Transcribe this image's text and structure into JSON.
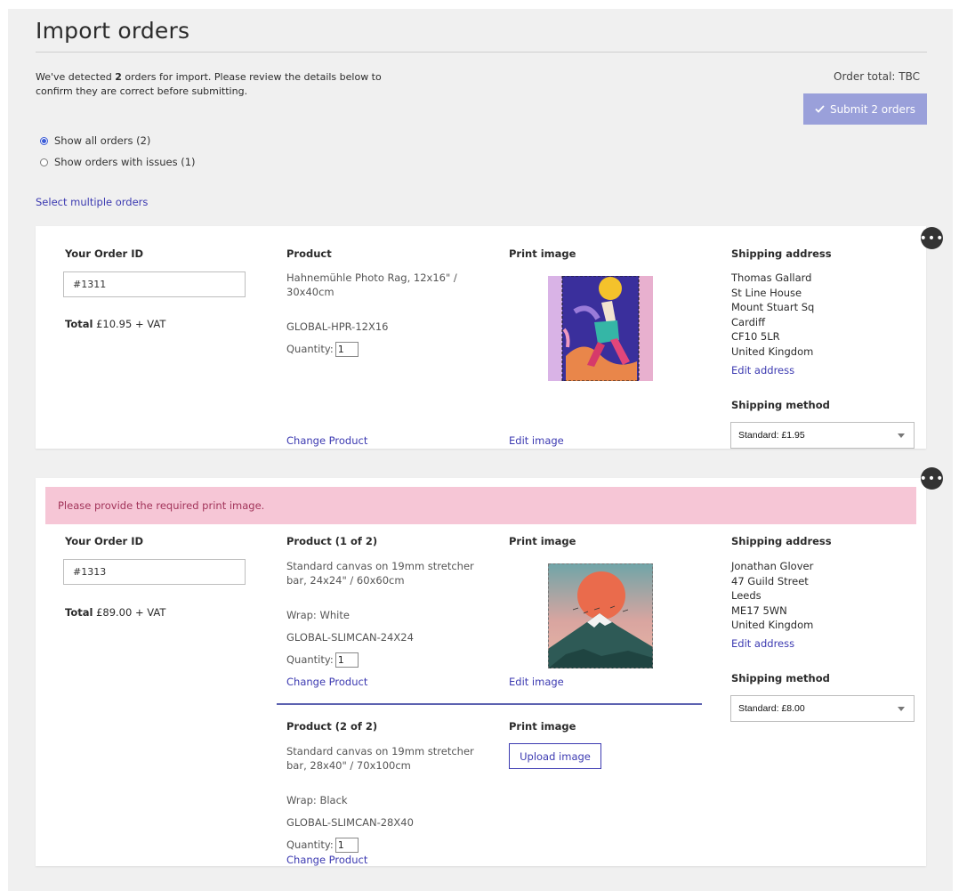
{
  "page": {
    "title": "Import orders",
    "intro_prefix": "We've detected ",
    "intro_count": "2",
    "intro_suffix": " orders for import. Please review the details below to confirm they are correct before submitting.",
    "order_total": "Order total: TBC",
    "submit_label": "Submit 2 orders",
    "filters": [
      {
        "label": "Show all orders (2)",
        "selected": true
      },
      {
        "label": "Show orders with issues (1)",
        "selected": false
      }
    ],
    "select_multiple": "Select multiple orders"
  },
  "labels": {
    "order_id": "Your Order ID",
    "print_image": "Print image",
    "shipping_address": "Shipping address",
    "shipping_method": "Shipping method",
    "total": "Total",
    "quantity": "Quantity:",
    "change_product": "Change Product",
    "edit_image": "Edit image",
    "edit_address": "Edit address",
    "upload_image": "Upload image"
  },
  "orders": [
    {
      "order_id": "#1311",
      "total_value": " £10.95 + VAT",
      "product_heading": "Product",
      "product_name_line1": "Hahnemühle Photo Rag, 12x16\" /",
      "product_name_line2": "30x40cm",
      "sku": "GLOBAL-HPR-12X16",
      "quantity": "1",
      "address": [
        "Thomas Gallard",
        "St Line House",
        "Mount Stuart Sq",
        "Cardiff",
        "CF10 5LR",
        "United Kingdom"
      ],
      "shipping_method": "Standard: £1.95"
    },
    {
      "alert": "Please provide the required print image.",
      "order_id": "#1313",
      "total_value": " £89.00 + VAT",
      "address": [
        "Jonathan Glover",
        "47 Guild Street",
        "Leeds",
        "ME17 5WN",
        "United Kingdom"
      ],
      "shipping_method": "Standard: £8.00",
      "products": [
        {
          "heading": "Product (1 of 2)",
          "name_line1": "Standard canvas on 19mm stretcher",
          "name_line2": "bar, 24x24\" / 60x60cm",
          "wrap": "Wrap: White",
          "sku": "GLOBAL-SLIMCAN-24X24",
          "quantity": "1"
        },
        {
          "heading": "Product (2 of 2)",
          "name_line1": "Standard canvas on 19mm stretcher",
          "name_line2": "bar, 28x40\" / 70x100cm",
          "wrap": "Wrap: Black",
          "sku": "GLOBAL-SLIMCAN-28X40",
          "quantity": "1"
        }
      ]
    }
  ],
  "colors": {
    "accent": "#3c3ab1",
    "submit_bg": "#9aa0da",
    "alert_bg": "#f6c6d6",
    "alert_text": "#a2345a"
  },
  "icons": {
    "submit": "check-icon",
    "more": "more-options-icon",
    "dropdown": "chevron-down-icon"
  }
}
